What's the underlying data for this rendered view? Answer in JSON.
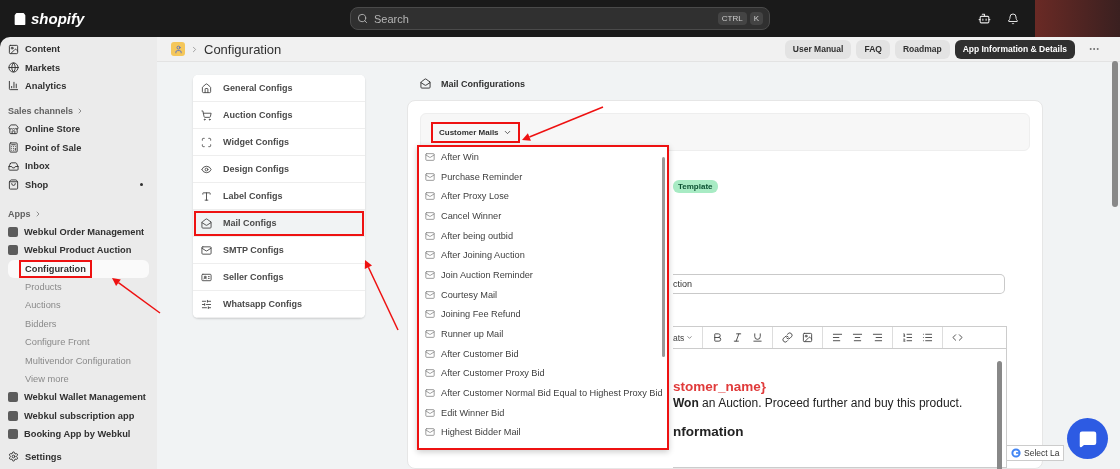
{
  "topbar": {
    "logo": "shopify",
    "search": {
      "placeholder": "Search",
      "keys": [
        "CTRL",
        "K"
      ]
    }
  },
  "sidebar": {
    "items": [
      {
        "kind": "nav",
        "label": "Content",
        "dot": false
      },
      {
        "kind": "nav",
        "label": "Markets",
        "dot": false
      },
      {
        "kind": "nav",
        "label": "Analytics",
        "dot": false
      },
      {
        "kind": "heading",
        "label": "Sales channels"
      },
      {
        "kind": "nav",
        "label": "Online Store",
        "dot": false
      },
      {
        "kind": "nav",
        "label": "Point of Sale",
        "dot": false
      },
      {
        "kind": "nav",
        "label": "Inbox",
        "dot": false
      },
      {
        "kind": "nav",
        "label": "Shop",
        "dot": true
      },
      {
        "kind": "heading",
        "label": "Apps"
      },
      {
        "kind": "app",
        "label": "Webkul Order Management"
      },
      {
        "kind": "app",
        "label": "Webkul Product Auction",
        "children": [
          {
            "label": "Configuration",
            "selected": true,
            "highlighted": true
          },
          {
            "label": "Products",
            "selected": false,
            "highlighted": false
          },
          {
            "label": "Auctions",
            "selected": false,
            "highlighted": false
          },
          {
            "label": "Bidders",
            "selected": false,
            "highlighted": false
          },
          {
            "label": "Configure Front",
            "selected": false,
            "highlighted": false
          },
          {
            "label": "Multivendor Configuration",
            "selected": false,
            "highlighted": false
          },
          {
            "label": "View more",
            "selected": false,
            "highlighted": false
          }
        ]
      },
      {
        "kind": "app",
        "label": "Webkul Wallet Management"
      },
      {
        "kind": "app",
        "label": "Webkul subscription app"
      },
      {
        "kind": "app",
        "label": "Booking App by Webkul"
      },
      {
        "kind": "settings",
        "label": "Settings"
      }
    ]
  },
  "header": {
    "title": "Configuration",
    "buttons": [
      {
        "label": "User Manual",
        "kind": "secondary"
      },
      {
        "label": "FAQ",
        "kind": "secondary"
      },
      {
        "label": "Roadmap",
        "kind": "secondary"
      },
      {
        "label": "App Information & Details",
        "kind": "primary"
      }
    ]
  },
  "config_menu": {
    "items": [
      {
        "label": "General Configs",
        "selected": false,
        "highlighted": false
      },
      {
        "label": "Auction Configs",
        "selected": false,
        "highlighted": false
      },
      {
        "label": "Widget Configs",
        "selected": false,
        "highlighted": false
      },
      {
        "label": "Design Configs",
        "selected": false,
        "highlighted": false
      },
      {
        "label": "Label Configs",
        "selected": false,
        "highlighted": false
      },
      {
        "label": "Mail Configs",
        "selected": true,
        "highlighted": true
      },
      {
        "label": "SMTP Configs",
        "selected": false,
        "highlighted": false
      },
      {
        "label": "Seller Configs",
        "selected": false,
        "highlighted": false
      },
      {
        "label": "Whatsapp Configs",
        "selected": false,
        "highlighted": false
      }
    ]
  },
  "section_title": "Mail Configurations",
  "mail_type": {
    "label": "Customer Mails",
    "expanded": true,
    "highlighted": true
  },
  "mail_list": {
    "highlighted": true,
    "items": [
      "After Win",
      "Purchase Reminder",
      "After Proxy Lose",
      "Cancel Winner",
      "After being outbid",
      "After Joining Auction",
      "Join Auction Reminder",
      "Courtesy Mail",
      "Joining Fee Refund",
      "Runner up Mail",
      "After Customer Bid",
      "After Customer Proxy Bid",
      "After Customer Normal Bid Equal to Highest Proxy Bid",
      "Edit Winner Bid",
      "Highest Bidder Mail"
    ]
  },
  "template_badge": "Template",
  "subject_value": "ction",
  "editor": {
    "format_label": "ats",
    "lines": [
      {
        "kind": "variable",
        "text": "stomer_name}"
      },
      {
        "kind": "text",
        "text": "**Won** an Auction. Proceed further and buy this product."
      },
      {
        "kind": "heading",
        "text": "nformation"
      }
    ]
  },
  "translate": {
    "label": "Select La"
  }
}
